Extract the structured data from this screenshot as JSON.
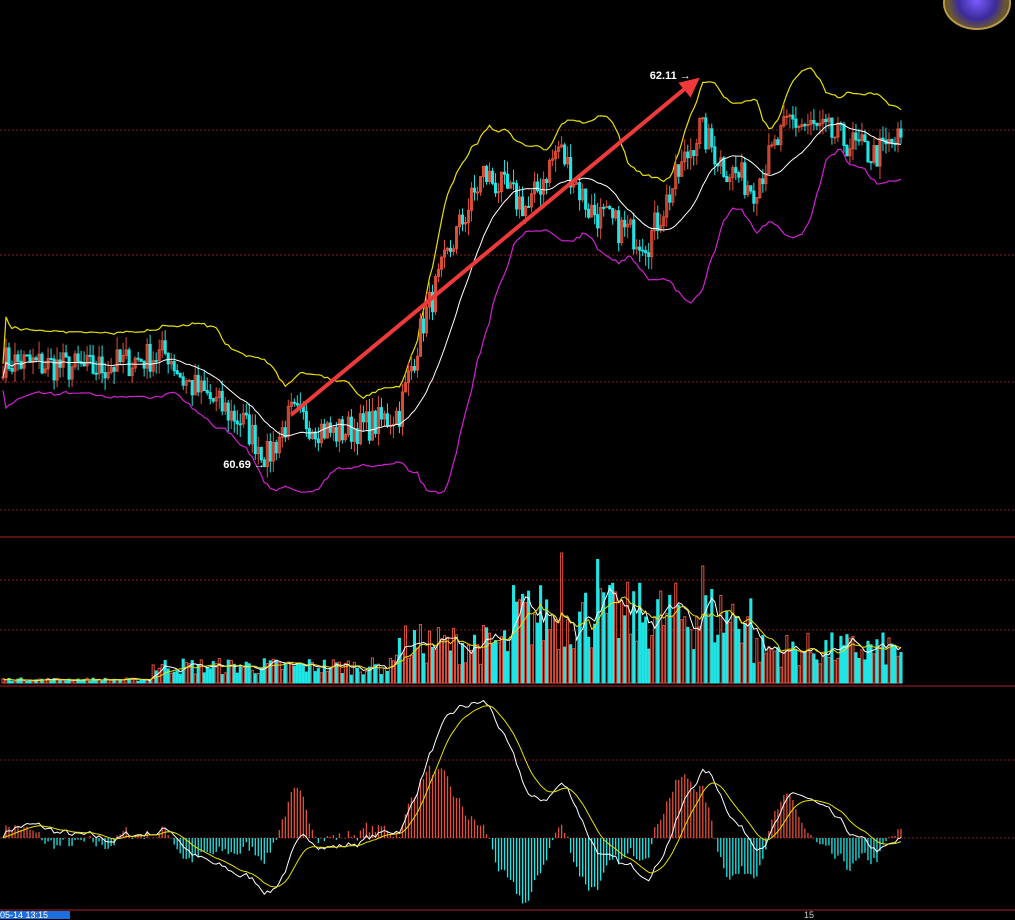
{
  "header": {
    "timestamp": "05-14 13:15"
  },
  "axis": {
    "time_tick": "15"
  },
  "logo": {
    "icon": "game-badge-icon"
  },
  "colors": {
    "up": "#e0503a",
    "down": "#1ee6e6",
    "ma": "#ffffff",
    "boll_upper": "#e8e000",
    "boll_lower": "#d020d0",
    "grid": "#8a1c1c",
    "arrow": "#ee3a3a",
    "signal": "#e8e000"
  },
  "chart_data": [
    {
      "type": "candlestick",
      "pane": "price",
      "annotations": [
        {
          "label": "60.69",
          "price": 60.69,
          "index": 88
        },
        {
          "label": "62.11",
          "price": 62.11,
          "index": 232
        }
      ],
      "trend_arrow": {
        "from": {
          "index": 96,
          "price": 60.85
        },
        "to": {
          "index": 232,
          "price": 62.11
        }
      },
      "ylim": [
        60.4,
        62.4
      ],
      "overlays": [
        "moving-average",
        "bollinger-upper",
        "bollinger-lower"
      ],
      "grid": true
    },
    {
      "type": "bar",
      "pane": "volume",
      "overlays": [
        "volume-ma-white",
        "volume-ma-yellow"
      ],
      "grid": true
    },
    {
      "type": "bar",
      "pane": "macd",
      "series": [
        {
          "values": "histogram"
        },
        {
          "values": "dif-line"
        },
        {
          "values": "dea-line"
        }
      ],
      "grid": true
    }
  ]
}
